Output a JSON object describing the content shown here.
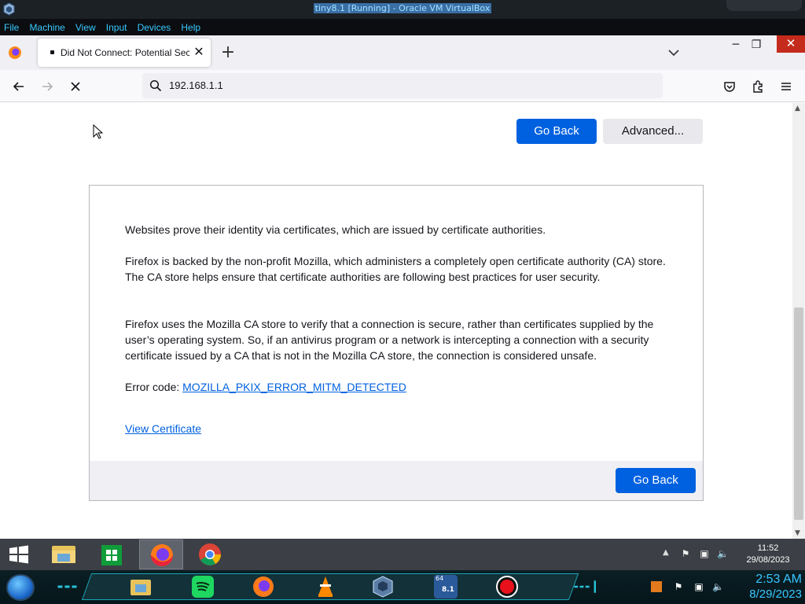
{
  "vbox": {
    "title": "tiny8.1 [Running] - Oracle VM VirtualBox",
    "menu": [
      "File",
      "Machine",
      "View",
      "Input",
      "Devices",
      "Help"
    ]
  },
  "browser": {
    "tab_title": "Did Not Connect: Potential Security Issue",
    "url": "192.168.1.1"
  },
  "page": {
    "go_back_label": "Go Back",
    "advanced_label": "Advanced...",
    "para1": "Websites prove their identity via certificates, which are issued by certificate authorities.",
    "para2": "Firefox is backed by the non-profit Mozilla, which administers a completely open certificate authority (CA) store. The CA store helps ensure that certificate authorities are following best practices for user security.",
    "para3": "Firefox uses the Mozilla CA store to verify that a connection is secure, rather than certificates supplied by the user’s operating system. So, if an antivirus program or a network is intercepting a connection with a security certificate issued by a CA that is not in the Mozilla CA store, the connection is considered unsafe.",
    "error_prefix": "Error code: ",
    "error_code": "MOZILLA_PKIX_ERROR_MITM_DETECTED",
    "view_certificate": "View Certificate"
  },
  "guest_taskbar": {
    "apps": [
      "file-explorer",
      "store",
      "firefox",
      "chrome"
    ],
    "active_app": "firefox",
    "time": "11:52",
    "date": "29/08/2023"
  },
  "host_dock": {
    "time": "2:53 AM",
    "date": "8/29/2023",
    "badge": "64",
    "badge2": "8.1"
  },
  "colors": {
    "accent": "#0061e0",
    "vbox_menu_text": "#38c8ff",
    "host_clock": "#39c6ff"
  }
}
